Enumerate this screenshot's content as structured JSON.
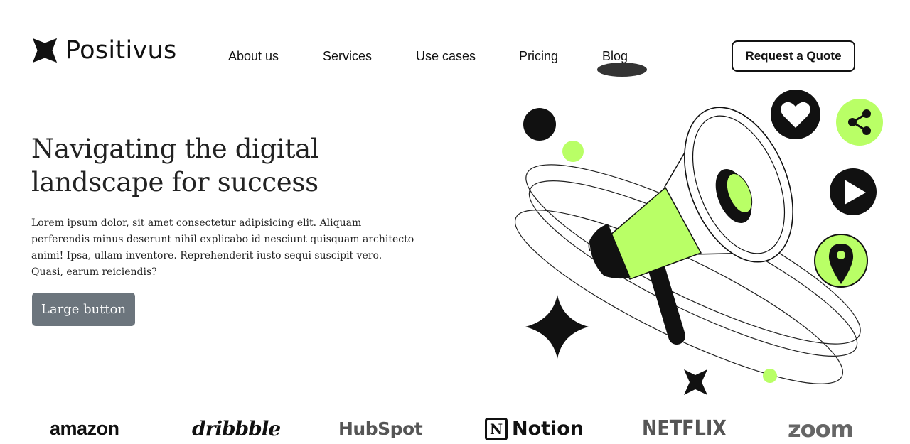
{
  "header": {
    "brand": "Positivus",
    "nav": [
      {
        "label": "About us"
      },
      {
        "label": "Services"
      },
      {
        "label": "Use cases"
      },
      {
        "label": "Pricing"
      },
      {
        "label": "Blog"
      }
    ],
    "cta_label": "Request a Quote"
  },
  "hero": {
    "title_line1": "Navigating the digital",
    "title_line2": "landscape for success",
    "description": "Lorem ipsum dolor, sit amet consectetur adipisicing elit. Aliquam perferendis minus deserunt nihil explicabo id nesciunt quisquam architecto animi! Ipsa, ullam inventore. Reprehenderit iusto sequi suscipit vero. Quasi, earum reiciendis?",
    "button_label": "Large button"
  },
  "illustration": {
    "icons": [
      "megaphone-icon",
      "heart-icon",
      "share-icon",
      "play-icon",
      "location-pin-icon",
      "sparkle-icon",
      "star-icon"
    ]
  },
  "logos": [
    {
      "name": "amazon"
    },
    {
      "name": "dribbble"
    },
    {
      "name": "HubSpot"
    },
    {
      "name": "Notion",
      "mark": "N"
    },
    {
      "name": "NETFLIX"
    },
    {
      "name": "zoom"
    }
  ],
  "colors": {
    "accent": "#b9ff66",
    "dark": "#111111",
    "button_gray": "#6c757d"
  }
}
